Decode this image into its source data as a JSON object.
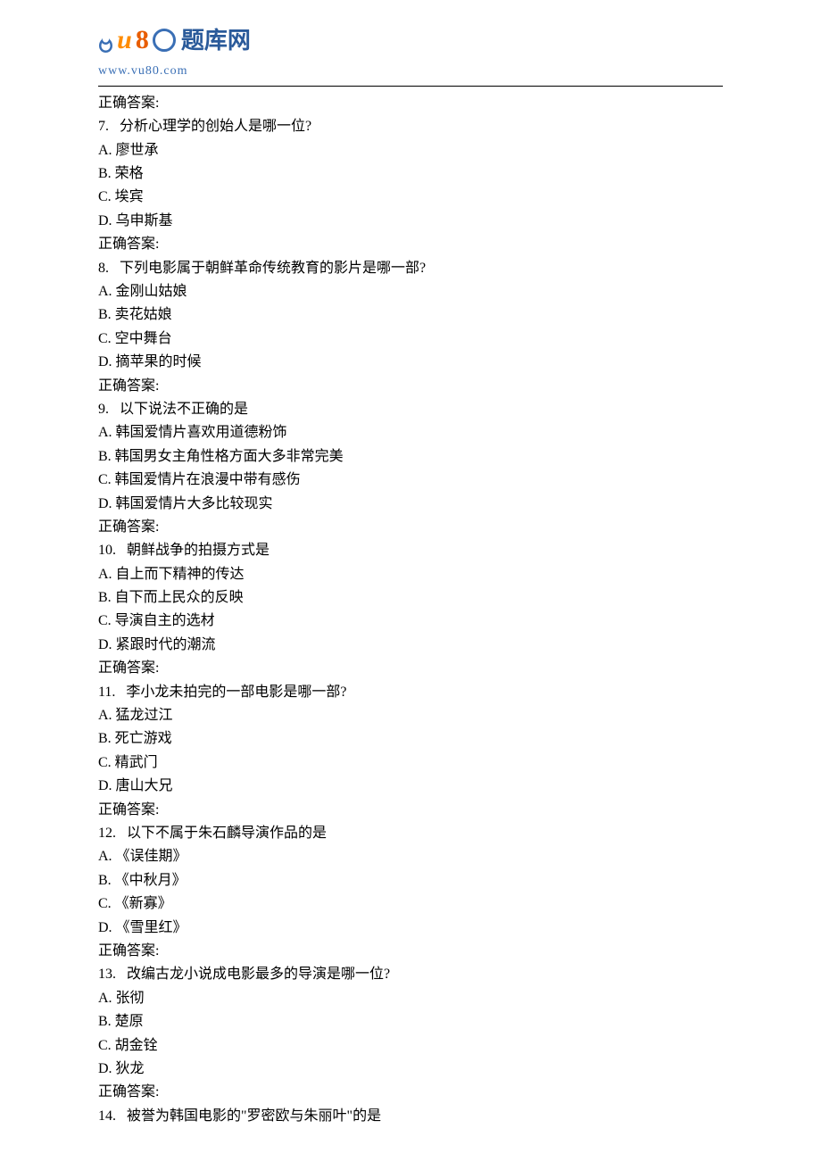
{
  "logo": {
    "brand_text": "题库网",
    "url": "www.vu80.com"
  },
  "answer_label": "正确答案:",
  "questions": [
    {
      "number": "7.",
      "text": "分析心理学的创始人是哪一位?",
      "options": [
        {
          "label": "A.",
          "text": "廖世承"
        },
        {
          "label": "B.",
          "text": "荣格"
        },
        {
          "label": "C.",
          "text": "埃宾"
        },
        {
          "label": "D.",
          "text": "乌申斯基"
        }
      ]
    },
    {
      "number": "8.",
      "text": "下列电影属于朝鲜革命传统教育的影片是哪一部?",
      "options": [
        {
          "label": "A.",
          "text": "金刚山姑娘"
        },
        {
          "label": "B.",
          "text": "卖花姑娘"
        },
        {
          "label": "C.",
          "text": "空中舞台"
        },
        {
          "label": "D.",
          "text": "摘苹果的时候"
        }
      ]
    },
    {
      "number": "9.",
      "text": "以下说法不正确的是",
      "options": [
        {
          "label": "A.",
          "text": "韩国爱情片喜欢用道德粉饰"
        },
        {
          "label": "B.",
          "text": "韩国男女主角性格方面大多非常完美"
        },
        {
          "label": "C.",
          "text": "韩国爱情片在浪漫中带有感伤"
        },
        {
          "label": "D.",
          "text": "韩国爱情片大多比较现实"
        }
      ]
    },
    {
      "number": "10.",
      "text": "朝鲜战争的拍摄方式是",
      "options": [
        {
          "label": "A.",
          "text": "自上而下精神的传达"
        },
        {
          "label": "B.",
          "text": "自下而上民众的反映"
        },
        {
          "label": "C.",
          "text": "导演自主的选材"
        },
        {
          "label": "D.",
          "text": "紧跟时代的潮流"
        }
      ]
    },
    {
      "number": "11.",
      "text": "李小龙未拍完的一部电影是哪一部?",
      "options": [
        {
          "label": "A.",
          "text": "猛龙过江"
        },
        {
          "label": "B.",
          "text": "死亡游戏"
        },
        {
          "label": "C.",
          "text": "精武门"
        },
        {
          "label": "D.",
          "text": "唐山大兄"
        }
      ]
    },
    {
      "number": "12.",
      "text": "以下不属于朱石麟导演作品的是",
      "options": [
        {
          "label": "A.",
          "text": "《误佳期》"
        },
        {
          "label": "B.",
          "text": "《中秋月》"
        },
        {
          "label": "C.",
          "text": "《新寡》"
        },
        {
          "label": "D.",
          "text": "《雪里红》"
        }
      ]
    },
    {
      "number": "13.",
      "text": "改编古龙小说成电影最多的导演是哪一位?",
      "options": [
        {
          "label": "A.",
          "text": "张彻"
        },
        {
          "label": "B.",
          "text": "楚原"
        },
        {
          "label": "C.",
          "text": "胡金铨"
        },
        {
          "label": "D.",
          "text": "狄龙"
        }
      ]
    },
    {
      "number": "14.",
      "text": "被誉为韩国电影的\"罗密欧与朱丽叶\"的是",
      "options": []
    }
  ]
}
